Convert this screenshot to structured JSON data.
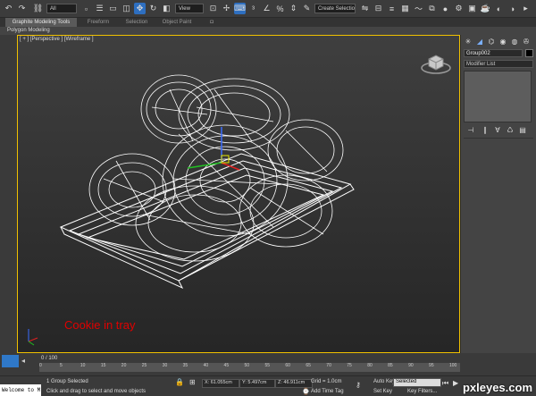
{
  "toolbar": {
    "filter_value": "All",
    "view_value": "View",
    "selection_set_value": "Create Selection Se"
  },
  "ribbon": {
    "tabs": [
      "Graphite Modeling Tools",
      "Freeform",
      "Selection",
      "Object Paint"
    ],
    "panel": "Polygon Modeling"
  },
  "viewport": {
    "label": "[ + ] [Perspective ] [Wireframe ]",
    "caption": "Cookie in tray",
    "caption_color": "#e00000",
    "border_color": "#f0c000"
  },
  "command_panel": {
    "object_name": "Group002",
    "modifier_list": "Modifier List"
  },
  "timeline": {
    "frame_label": "0 / 100",
    "ticks": [
      "0",
      "5",
      "10",
      "15",
      "20",
      "25",
      "30",
      "35",
      "40",
      "45",
      "50",
      "55",
      "60",
      "65",
      "70",
      "75",
      "80",
      "85",
      "90",
      "95",
      "100"
    ]
  },
  "status": {
    "script_text": "Welcome to M:",
    "selected_text": "1 Group Selected",
    "prompt_text": "Click and drag to select and move objects",
    "x_value": "X: 61.055cm",
    "y_value": "Y: 5.497cm",
    "z_value": "Z: 46.911cm",
    "grid": "Grid = 1.0cm",
    "add_time_tag": "Add Time Tag",
    "auto_key": "Auto Key",
    "set_key": "Set Key",
    "key_mode": "Selected",
    "key_filters": "Key Filters..."
  },
  "watermark": "pxleyes.com"
}
